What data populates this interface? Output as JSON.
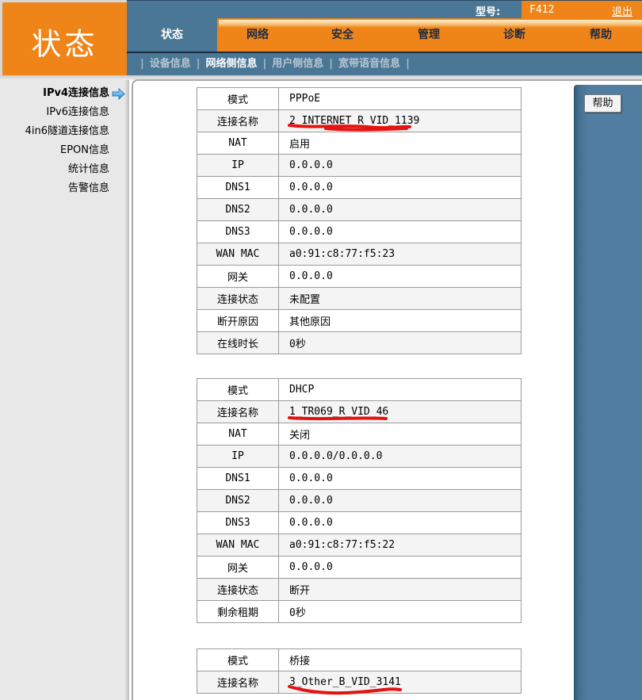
{
  "header": {
    "model_label": "型号:",
    "model_value": "F412",
    "logout_label": "退出",
    "brand_title": "状态",
    "tabs": [
      {
        "label": "状态",
        "active": true
      },
      {
        "label": "网络",
        "active": false
      },
      {
        "label": "安全",
        "active": false
      },
      {
        "label": "管理",
        "active": false
      },
      {
        "label": "诊断",
        "active": false
      },
      {
        "label": "帮助",
        "active": false
      }
    ],
    "subnav": [
      {
        "label": "设备信息",
        "active": false
      },
      {
        "label": "网络侧信息",
        "active": true
      },
      {
        "label": "用户侧信息",
        "active": false
      },
      {
        "label": "宽带语音信息",
        "active": false
      }
    ]
  },
  "sidebar": {
    "items": [
      {
        "label": "IPv4连接信息",
        "active": true
      },
      {
        "label": "IPv6连接信息",
        "active": false
      },
      {
        "label": "4in6隧道连接信息",
        "active": false
      },
      {
        "label": "EPON信息",
        "active": false
      },
      {
        "label": "统计信息",
        "active": false
      },
      {
        "label": "告警信息",
        "active": false
      }
    ]
  },
  "help_panel": {
    "help_button_label": "帮助"
  },
  "connection_tables": [
    {
      "rows": [
        {
          "label": "模式",
          "value": "PPPoE"
        },
        {
          "label": "连接名称",
          "value": "2_INTERNET_R_VID_1139",
          "underlined": true
        },
        {
          "label": "NAT",
          "value": "启用"
        },
        {
          "label": "IP",
          "value": "0.0.0.0"
        },
        {
          "label": "DNS1",
          "value": "0.0.0.0"
        },
        {
          "label": "DNS2",
          "value": "0.0.0.0"
        },
        {
          "label": "DNS3",
          "value": "0.0.0.0"
        },
        {
          "label": "WAN MAC",
          "value": "a0:91:c8:77:f5:23"
        },
        {
          "label": "网关",
          "value": "0.0.0.0"
        },
        {
          "label": "连接状态",
          "value": "未配置"
        },
        {
          "label": "断开原因",
          "value": "其他原因"
        },
        {
          "label": "在线时长",
          "value": "0秒"
        }
      ]
    },
    {
      "rows": [
        {
          "label": "模式",
          "value": "DHCP"
        },
        {
          "label": "连接名称",
          "value": "1_TR069_R_VID_46",
          "underlined": true
        },
        {
          "label": "NAT",
          "value": "关闭"
        },
        {
          "label": "IP",
          "value": "0.0.0.0/0.0.0.0"
        },
        {
          "label": "DNS1",
          "value": "0.0.0.0"
        },
        {
          "label": "DNS2",
          "value": "0.0.0.0"
        },
        {
          "label": "DNS3",
          "value": "0.0.0.0"
        },
        {
          "label": "WAN MAC",
          "value": "a0:91:c8:77:f5:22"
        },
        {
          "label": "网关",
          "value": "0.0.0.0"
        },
        {
          "label": "连接状态",
          "value": "断开"
        },
        {
          "label": "剩余租期",
          "value": "0秒"
        }
      ]
    },
    {
      "rows": [
        {
          "label": "模式",
          "value": "桥接"
        },
        {
          "label": "连接名称",
          "value": "3_Other_B_VID_3141",
          "underlined": true
        }
      ]
    }
  ],
  "colors": {
    "accent_orange": "#ef8519",
    "steel_blue": "#4a7795",
    "annotation_red": "#e41311"
  }
}
